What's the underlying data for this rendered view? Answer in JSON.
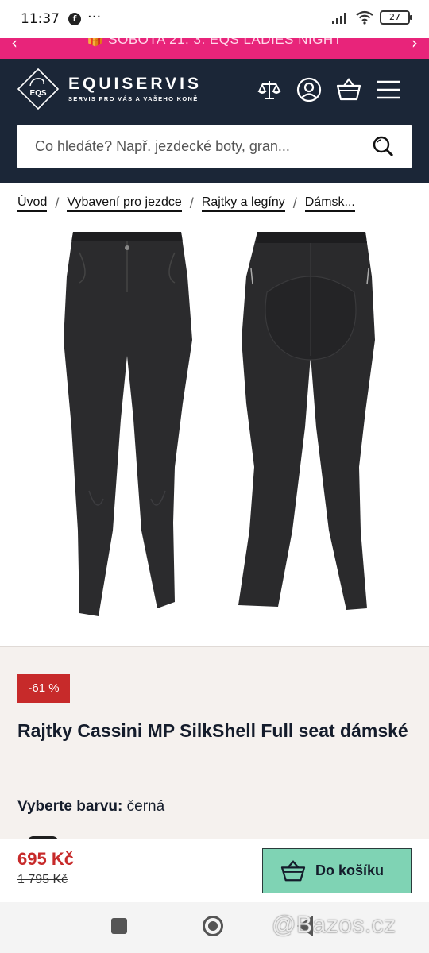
{
  "status": {
    "time": "11:37",
    "fb": "f",
    "more": "···",
    "battery": "27"
  },
  "promo": {
    "text": "🎁 SOBOTA 21. 3. EQS LADIES NIGHT",
    "prev": "‹",
    "next": "›"
  },
  "header": {
    "brand": "EQUISERVIS",
    "tagline": "SERVIS PRO VÁS A VAŠEHO KONĚ",
    "logo_text": "EQS",
    "icons": [
      "compare-icon",
      "user-icon",
      "basket-icon",
      "menu-icon"
    ]
  },
  "search": {
    "placeholder": "Co hledáte? Např. jezdecké boty, gran..."
  },
  "breadcrumbs": {
    "items": [
      "Úvod",
      "Vybavení pro jezdce",
      "Rajtky a legíny",
      "Dámsk..."
    ],
    "separator": "/"
  },
  "product": {
    "discount": "-61 %",
    "title": "Rajtky Cassini MP SilkShell Full seat dámské",
    "color_label": "Vyberte barvu:",
    "color_value": "černá",
    "price": "695 Kč",
    "old_price": "1 795 Kč",
    "cart_label": "Do košíku",
    "colors": {
      "accent": "#c72a2a",
      "cart": "#7fd3b4",
      "header": "#1b2637",
      "promo": "#e8247a"
    }
  },
  "watermark": "@Bazos.cz"
}
